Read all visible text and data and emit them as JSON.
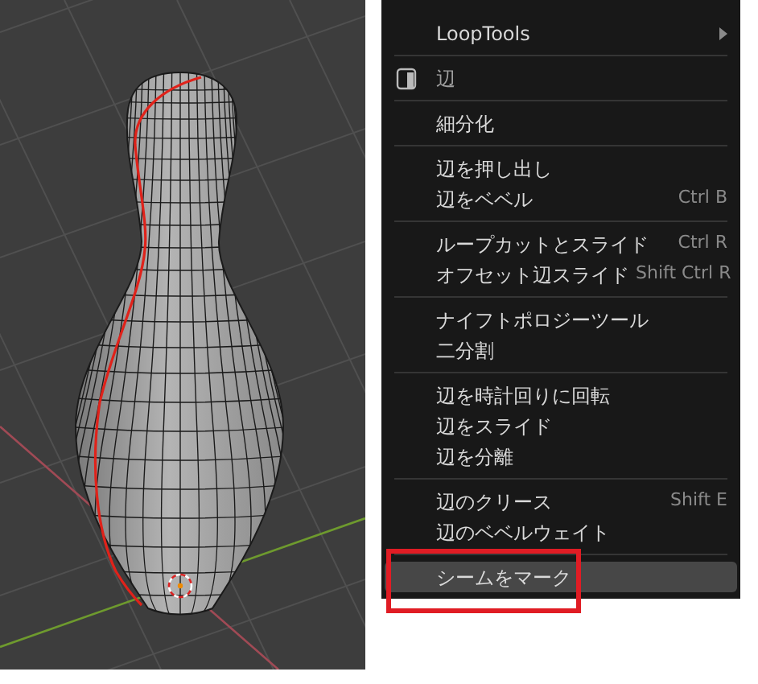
{
  "menu": {
    "sections": [
      {
        "items": [
          {
            "kind": "submenu",
            "label": "LoopTools",
            "selected": false
          }
        ]
      },
      {
        "items": [
          {
            "kind": "header",
            "label": "辺",
            "selected": false
          }
        ]
      },
      {
        "items": [
          {
            "kind": "item",
            "label": "細分化",
            "selected": false
          }
        ]
      },
      {
        "items": [
          {
            "kind": "item",
            "label": "辺を押し出し",
            "selected": false
          },
          {
            "kind": "item",
            "label": "辺をベベル",
            "shortcut": "Ctrl B",
            "selected": false
          }
        ]
      },
      {
        "items": [
          {
            "kind": "item",
            "label": "ループカットとスライド",
            "shortcut": "Ctrl R",
            "selected": false
          },
          {
            "kind": "item",
            "label": "オフセット辺スライド",
            "shortcut": "Shift Ctrl R",
            "selected": false
          }
        ]
      },
      {
        "items": [
          {
            "kind": "item",
            "label": "ナイフトポロジーツール",
            "selected": false
          },
          {
            "kind": "item",
            "label": "二分割",
            "selected": false
          }
        ]
      },
      {
        "items": [
          {
            "kind": "item",
            "label": "辺を時計回りに回転",
            "selected": false
          },
          {
            "kind": "item",
            "label": "辺をスライド",
            "selected": false
          },
          {
            "kind": "item",
            "label": "辺を分離",
            "selected": false
          }
        ]
      },
      {
        "items": [
          {
            "kind": "item",
            "label": "辺のクリース",
            "shortcut": "Shift E",
            "selected": false
          },
          {
            "kind": "item",
            "label": "辺のベベルウェイト",
            "selected": false
          }
        ]
      },
      {
        "items": [
          {
            "kind": "item",
            "label": "シームをマーク",
            "selected": true
          }
        ]
      }
    ]
  }
}
